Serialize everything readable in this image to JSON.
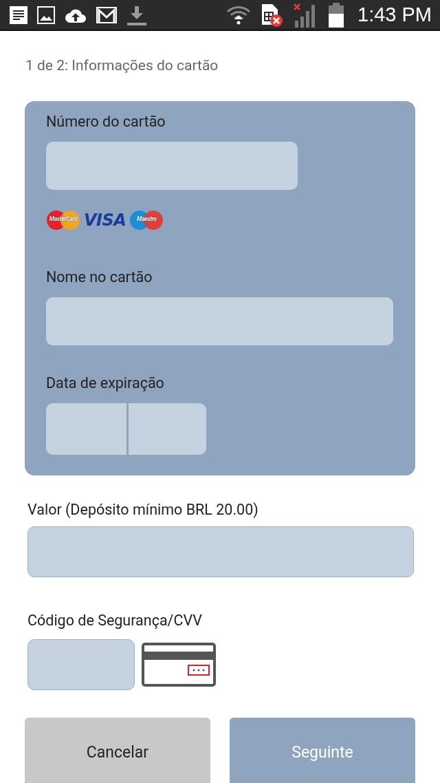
{
  "status_bar": {
    "time": "1:43 PM"
  },
  "step_title": "1 de 2: Informações do cartão",
  "card_panel": {
    "card_number": {
      "label": "Número do cartão"
    },
    "card_brands": [
      {
        "kind": "mastercard",
        "text": "MasterCard"
      },
      {
        "kind": "visa",
        "text": "VISA"
      },
      {
        "kind": "maestro",
        "text": "Maestro"
      }
    ],
    "name_on_card": {
      "label": "Nome no cartão"
    },
    "expiry": {
      "label": "Data de expiração"
    }
  },
  "amount": {
    "label": "Valor (Depósito mínimo BRL 20.00)"
  },
  "cvv": {
    "label": "Código de Segurança/CVV"
  },
  "buttons": [
    {
      "kind": "cancel",
      "label": "Cancelar"
    },
    {
      "kind": "next",
      "label": "Seguinte"
    }
  ]
}
